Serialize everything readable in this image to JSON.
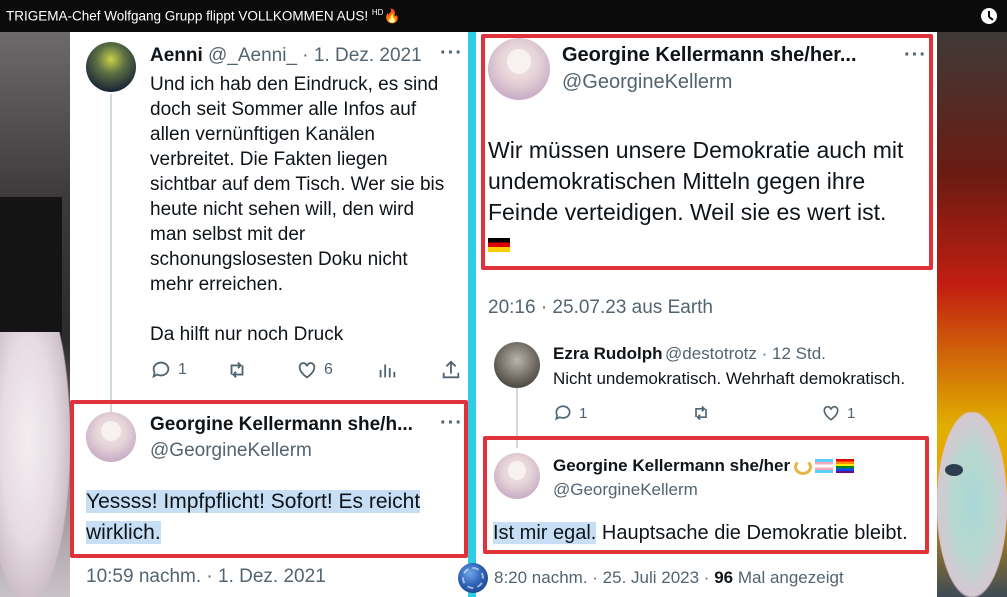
{
  "video": {
    "title": "TRIGEMA-Chef Wolfgang Grupp flippt VOLLKOMMEN AUS!",
    "title_badge": "HD",
    "clock_icon": "clock-icon"
  },
  "left_panel": {
    "tweet_aenni": {
      "name": "Aenni",
      "handle": "@_Aenni_ · 1. Dez. 2021",
      "more": "···",
      "lines": [
        "Und ich hab den Eindruck, es sind",
        "doch seit Sommer alle Infos auf",
        "allen vernünftigen Kanälen",
        "verbreitet. Die Fakten liegen",
        "sichtbar auf dem Tisch. Wer sie bis",
        "heute nicht sehen will, den wird",
        "man selbst mit der",
        "schonungslosesten Doku nicht",
        "mehr erreichen.",
        "Da hilft nur noch Druck"
      ],
      "actions": {
        "reply_count": "1",
        "retweet_count": "",
        "like_count": "6"
      }
    },
    "tweet_georgine_1": {
      "name": "Georgine Kellermann she/h...",
      "handle": "@GeorgineKellerm",
      "more": "···",
      "lines": [
        "Yessss! Impfpflicht! Sofort! Es reicht",
        "wirklich."
      ],
      "timestamp": "10:59 nachm. · 1. Dez. 2021"
    }
  },
  "right_panel": {
    "tweet_georgine_main": {
      "name": "Georgine Kellermann she/her...",
      "handle": "@GeorgineKellerm",
      "more": "···",
      "lines": [
        "Wir müssen unsere Demokratie auch mit",
        "undemokratischen Mitteln gegen ihre",
        "Feinde verteidigen. Weil sie es wert ist."
      ],
      "timestamp": "20:16 · 25.07.23 aus Earth"
    },
    "reply_ezra": {
      "name": "Ezra Rudolph",
      "handle": "@destotrotz · 12 Std.",
      "text": "Nicht undemokratisch. Wehrhaft demokratisch.",
      "actions": {
        "reply_count": "1",
        "like_count": "1"
      }
    },
    "reply_georgine": {
      "name": "Georgine Kellermann she/her",
      "handle": "@GeorgineKellerm",
      "text_highlight": "Ist mir egal.",
      "text_rest": " Hauptsache die Demokratie bleibt.",
      "timestamp": "8:20 nachm. · 25. Juli 2023 · ",
      "views": "96",
      "views_label": " Mal angezeigt"
    }
  },
  "colors": {
    "accent_red_box": "#e0323b",
    "divider_cyan": "#2fcde4",
    "highlight_blue": "#c7def4",
    "text_secondary": "#536471"
  }
}
